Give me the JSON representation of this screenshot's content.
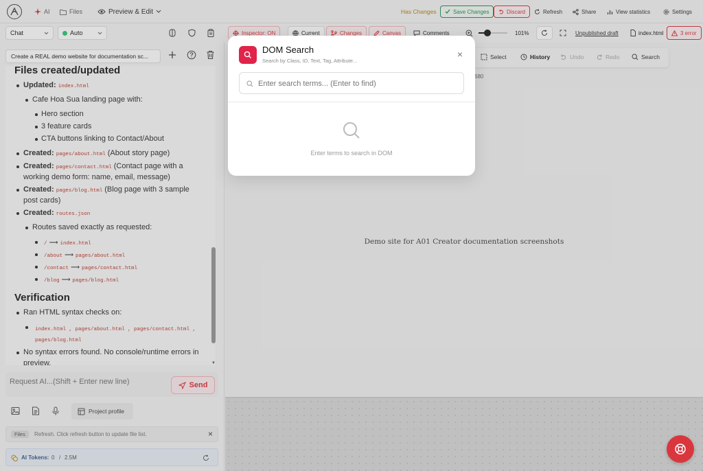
{
  "topbar": {
    "ai_label": "AI",
    "files_label": "Files",
    "preview_label": "Preview & Edit",
    "has_changes": "Has Changes",
    "save_changes": "Save Changes",
    "discard": "Discard",
    "refresh": "Refresh",
    "share": "Share",
    "view_statistics": "View statistics",
    "settings": "Settings"
  },
  "toolbar": {
    "mode": "Chat",
    "model": "Auto",
    "inspector": "Inspector: ON",
    "current": "Current",
    "changes": "Changes",
    "canvas": "Canvas",
    "comments": "Comments",
    "zoom": "101%",
    "unpublished": "Unpublished draft",
    "file": "index.html",
    "errors": "3 error"
  },
  "canvas_toolbar": {
    "select": "Select",
    "history": "History",
    "undo": "Undo",
    "redo": "Redo",
    "search": "Search",
    "dims": "680"
  },
  "chat": {
    "task_title": "Create a REAL demo website for documentation sc...",
    "heading_files": "Files created/updated",
    "updated_label": "Updated:",
    "updated_file": "index.html",
    "landing_text": "Cafe Hoa Sua landing page with:",
    "hero": "Hero section",
    "cards": "3 feature cards",
    "cta": "CTA buttons linking to Contact/About",
    "created_label": "Created:",
    "about_file": "pages/about.html",
    "about_desc": "(About story page)",
    "contact_file": "pages/contact.html",
    "contact_desc_1": "(Contact page with a",
    "contact_desc_2": "working demo form: name, email, message)",
    "blog_file": "pages/blog.html",
    "blog_desc_1": "(Blog page with 3 sample",
    "blog_desc_2": "post cards)",
    "routes_file": "routes.json",
    "routes_saved": "Routes saved exactly as requested:",
    "routes": [
      {
        "from": "/",
        "to": "index.html"
      },
      {
        "from": "/about",
        "to": "pages/about.html"
      },
      {
        "from": "/contact",
        "to": "pages/contact.html"
      },
      {
        "from": "/blog",
        "to": "pages/blog.html"
      }
    ],
    "arrow": "⟶",
    "heading_verification": "Verification",
    "syntax_checks": "Ran HTML syntax checks on:",
    "checked_files_1": "index.html , pages/about.html , pages/contact.html ,",
    "checked_files_2": "pages/blog.html",
    "no_errors_1": "No syntax errors found. No console/runtime errors in",
    "no_errors_2": "preview.",
    "input_placeholder": "Request AI...(Shift + Enter new line)",
    "send": "Send",
    "project_profile": "Project profile",
    "files_tag": "Files",
    "files_notice": "Refresh. Click refresh button to update file list.",
    "tokens_label": "AI Tokens:",
    "tokens_used": "0",
    "tokens_sep": "/",
    "tokens_total": "2.5M"
  },
  "canvas_text": "Demo site for A01 Creator documentation screenshots",
  "modal": {
    "title": "DOM Search",
    "subtitle": "Search by Class, ID, Text, Tag, Attribute...",
    "placeholder": "Enter search terms... (Enter to find)",
    "empty_text": "Enter terms to search in DOM"
  },
  "colors": {
    "accent": "#e0244a",
    "save_green": "#2e8b57",
    "discard_red": "#d9363e",
    "has_changes": "#b8860b"
  }
}
